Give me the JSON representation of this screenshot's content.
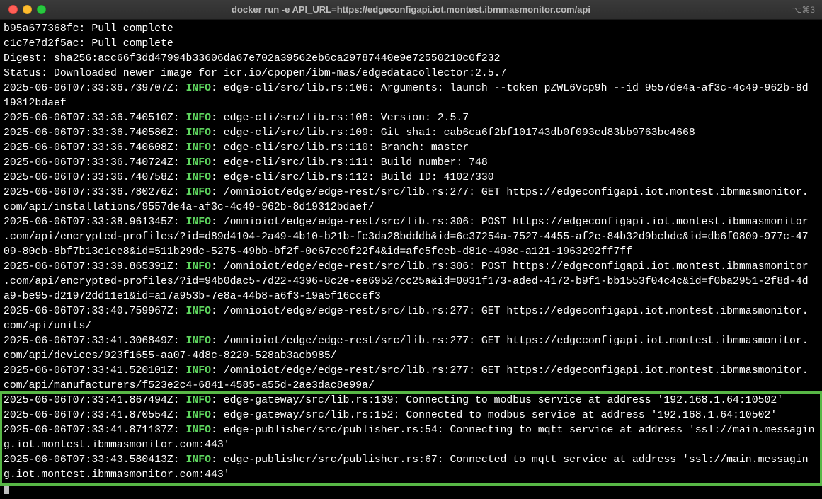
{
  "window": {
    "title": "docker run -e API_URL=https://edgeconfigapi.iot.montest.ibmmasmonitor.com/api",
    "shortcut": "⌥⌘3"
  },
  "colors": {
    "background": "#000000",
    "text": "#ffffff",
    "info": "#5fd75f",
    "highlight_border": "#58b846"
  },
  "terminal": {
    "lines": [
      {
        "text": "b95a677368fc: Pull complete"
      },
      {
        "text": "c1c7e7d2f5ac: Pull complete"
      },
      {
        "text": "Digest: sha256:acc66f3dd47994b33606da67e702a39562eb6ca29787440e9e72550210c0f232"
      },
      {
        "text": "Status: Downloaded newer image for icr.io/cpopen/ibm-mas/edgedatacollector:2.5.7"
      },
      {
        "pre": "2025-06-06T07:33:36.739707Z: ",
        "level": "INFO",
        "post": ": edge-cli/src/lib.rs:106: Arguments: launch --token pZWL6Vcp9h --id 9557de4a-af3c-4c49-962b-8d"
      },
      {
        "text": "19312bdaef"
      },
      {
        "pre": "2025-06-06T07:33:36.740510Z: ",
        "level": "INFO",
        "post": ": edge-cli/src/lib.rs:108: Version: 2.5.7"
      },
      {
        "pre": "2025-06-06T07:33:36.740586Z: ",
        "level": "INFO",
        "post": ": edge-cli/src/lib.rs:109: Git sha1: cab6ca6f2bf101743db0f093cd83bb9763bc4668"
      },
      {
        "pre": "2025-06-06T07:33:36.740608Z: ",
        "level": "INFO",
        "post": ": edge-cli/src/lib.rs:110: Branch: master"
      },
      {
        "pre": "2025-06-06T07:33:36.740724Z: ",
        "level": "INFO",
        "post": ": edge-cli/src/lib.rs:111: Build number: 748"
      },
      {
        "pre": "2025-06-06T07:33:36.740758Z: ",
        "level": "INFO",
        "post": ": edge-cli/src/lib.rs:112: Build ID: 41027330"
      },
      {
        "pre": "2025-06-06T07:33:36.780276Z: ",
        "level": "INFO",
        "post": ": /omnioiot/edge/edge-rest/src/lib.rs:277: GET https://edgeconfigapi.iot.montest.ibmmasmonitor."
      },
      {
        "text": "com/api/installations/9557de4a-af3c-4c49-962b-8d19312bdaef/"
      },
      {
        "pre": "2025-06-06T07:33:38.961345Z: ",
        "level": "INFO",
        "post": ": /omnioiot/edge/edge-rest/src/lib.rs:306: POST https://edgeconfigapi.iot.montest.ibmmasmonitor"
      },
      {
        "text": ".com/api/encrypted-profiles/?id=d89d4104-2a49-4b10-b21b-fe3da28bdddb&id=6c37254a-7527-4455-af2e-84b32d9bcbdc&id=db6f0809-977c-47"
      },
      {
        "text": "09-80eb-8bf7b13c1ee8&id=511b29dc-5275-49bb-bf2f-0e67cc0f22f4&id=afc5fceb-d81e-498c-a121-1963292ff7ff"
      },
      {
        "pre": "2025-06-06T07:33:39.865391Z: ",
        "level": "INFO",
        "post": ": /omnioiot/edge/edge-rest/src/lib.rs:306: POST https://edgeconfigapi.iot.montest.ibmmasmonitor"
      },
      {
        "text": ".com/api/encrypted-profiles/?id=94b0dac5-7d22-4396-8c2e-ee69527cc25a&id=0031f173-aded-4172-b9f1-bb1553f04c4c&id=f0ba2951-2f8d-4d"
      },
      {
        "text": "a9-be95-d21972dd11e1&id=a17a953b-7e8a-44b8-a6f3-19a5f16ccef3"
      },
      {
        "pre": "2025-06-06T07:33:40.759967Z: ",
        "level": "INFO",
        "post": ": /omnioiot/edge/edge-rest/src/lib.rs:277: GET https://edgeconfigapi.iot.montest.ibmmasmonitor."
      },
      {
        "text": "com/api/units/"
      },
      {
        "pre": "2025-06-06T07:33:41.306849Z: ",
        "level": "INFO",
        "post": ": /omnioiot/edge/edge-rest/src/lib.rs:277: GET https://edgeconfigapi.iot.montest.ibmmasmonitor."
      },
      {
        "text": "com/api/devices/923f1655-aa07-4d8c-8220-528ab3acb985/"
      },
      {
        "pre": "2025-06-06T07:33:41.520101Z: ",
        "level": "INFO",
        "post": ": /omnioiot/edge/edge-rest/src/lib.rs:277: GET https://edgeconfigapi.iot.montest.ibmmasmonitor."
      },
      {
        "text": "com/api/manufacturers/f523e2c4-6841-4585-a55d-2ae3dac8e99a/"
      },
      {
        "pre": "2025-06-06T07:33:41.867494Z: ",
        "level": "INFO",
        "post": ": edge-gateway/src/lib.rs:139: Connecting to modbus service at address '192.168.1.64:10502'"
      },
      {
        "pre": "2025-06-06T07:33:41.870554Z: ",
        "level": "INFO",
        "post": ": edge-gateway/src/lib.rs:152: Connected to modbus service at address '192.168.1.64:10502'"
      },
      {
        "pre": "2025-06-06T07:33:41.871137Z: ",
        "level": "INFO",
        "post": ": edge-publisher/src/publisher.rs:54: Connecting to mqtt service at address 'ssl://main.messagin"
      },
      {
        "text": "g.iot.montest.ibmmasmonitor.com:443'"
      },
      {
        "pre": "2025-06-06T07:33:43.580413Z: ",
        "level": "INFO",
        "post": ": edge-publisher/src/publisher.rs:67: Connected to mqtt service at address 'ssl://main.messagin"
      },
      {
        "text": "g.iot.montest.ibmmasmonitor.com:443'"
      }
    ]
  }
}
